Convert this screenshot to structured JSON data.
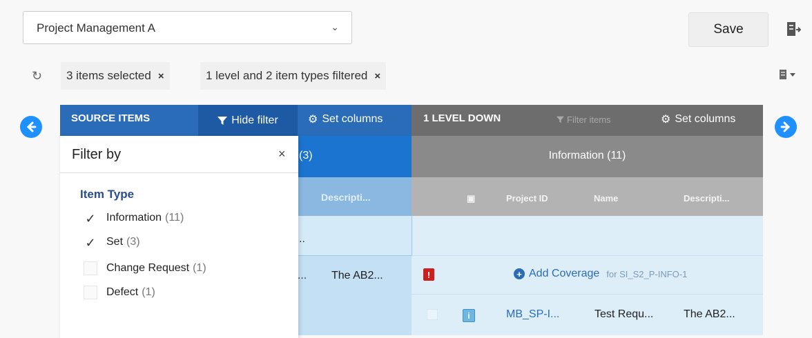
{
  "toolbar": {
    "project_value": "Project Management A",
    "save_label": "Save"
  },
  "chips": {
    "items_selected": "3 items selected",
    "filtered": "1 level and 2 item types filtered",
    "close_glyph": "×"
  },
  "source_panel": {
    "title": "SOURCE ITEMS",
    "hide_filter_label": "Hide filter",
    "set_columns_label": "Set columns",
    "count": "(3)",
    "description_header": "Descripti...",
    "row1_text": "..",
    "row2_name": "u...",
    "row2_description": "The AB2..."
  },
  "level_panel": {
    "title": "1 LEVEL DOWN",
    "filter_items_label": "Filter items",
    "set_columns_label": "Set columns",
    "band_title": "Information (11)",
    "col_project_id": "Project ID",
    "col_name": "Name",
    "col_description": "Descripti...",
    "alert_glyph": "!",
    "add_coverage_label": "Add Coverage",
    "add_coverage_for": "for SI_S2_P-INFO-1",
    "row3_link": "MB_SP-I...",
    "row3_name": "Test Requ...",
    "row3_description": "The AB2..."
  },
  "filter": {
    "title": "Filter by",
    "close_glyph": "×",
    "group_title": "Item Type",
    "options": [
      {
        "label": "Information",
        "count": "(11)",
        "checked": true
      },
      {
        "label": "Set",
        "count": "(3)",
        "checked": true
      },
      {
        "label": "Change Request",
        "count": "(1)",
        "checked": false
      },
      {
        "label": "Defect",
        "count": "(1)",
        "checked": false
      }
    ]
  },
  "icons": {
    "refresh": "refresh-icon",
    "export": "export-icon",
    "document_menu": "document-menu-icon",
    "nav_left": "arrow-left-circle-icon",
    "nav_right": "arrow-right-circle-icon",
    "funnel": "funnel-icon",
    "gear": "gear-icon"
  },
  "colors": {
    "source_header": "#2a6cb8",
    "source_band": "#1b75d0",
    "level_header": "#6d6d6d",
    "level_band": "#8a8a8a",
    "nav_arrow": "#1e90ff",
    "link": "#2a6cb8",
    "alert": "#cc1f1f"
  }
}
